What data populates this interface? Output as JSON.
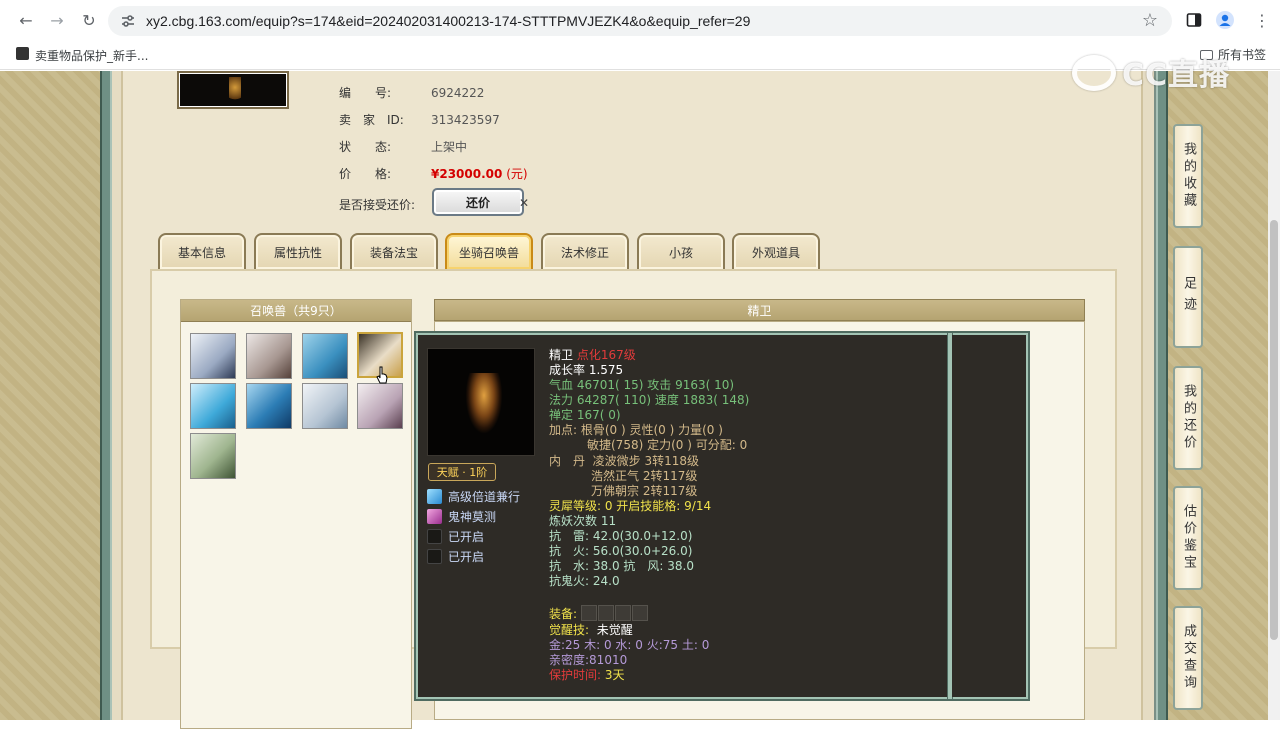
{
  "browser": {
    "url": "xy2.cbg.163.com/equip?s=174&eid=202402031400213-174-STTTPMVJEZK4&o&equip_refer=29",
    "bookmark": "卖重物品保护_新手...",
    "all_bookmarks": "所有书签",
    "watermark": "CC直播"
  },
  "item": {
    "rows": [
      {
        "label": "编　　号:",
        "value": "6924222"
      },
      {
        "label": "卖　家　ID:",
        "value": "313423597"
      },
      {
        "label": "状　　态:",
        "value": "上架中"
      },
      {
        "label": "价　　格:",
        "value": "¥23000.00",
        "unit": "(元)"
      }
    ],
    "counter_label": "是否接受还价:",
    "counter_button": "还价",
    "close_mark": "✕"
  },
  "tabs": [
    "基本信息",
    "属性抗性",
    "装备法宝",
    "坐骑召唤兽",
    "法术修正",
    "小孩",
    "外观道具"
  ],
  "active_tab": 3,
  "pet_panel": {
    "title": "召唤兽（共9只）",
    "selected": 3
  },
  "detail_title": "精卫",
  "tooltip": {
    "name": "精卫",
    "level": "点化167级",
    "growth": "成长率 1.575",
    "hp": "气血 46701( 15)",
    "attack": "攻击 9163( 10)",
    "mp": "法力 64287( 110)",
    "speed": "速度 1883( 148)",
    "zen": "禅定 167( 0)",
    "points1": "加点:  根骨(0 ) 灵性(0 ) 力量(0 )",
    "points2": "敏捷(758) 定力(0 ) 可分配:  0",
    "neidan_label": "内　丹",
    "neidan1": "凌波微步 3转118级",
    "neidan2": "浩然正气 2转117级",
    "neidan3": "万佛朝宗 2转117级",
    "lingxi": "灵犀等级:  0  开启技能格:  9/14",
    "lianyao": "炼妖次数 11",
    "res1": "抗　雷: 42.0(30.0+12.0)",
    "res2": "抗　火: 56.0(30.0+26.0)",
    "res3": "抗　水: 38.0 抗　风: 38.0",
    "res4": "抗鬼火: 24.0",
    "equip_label": "装备:",
    "awaken_label": "觉醒技:",
    "awaken_value": "未觉醒",
    "elements": "金:25 木: 0 水: 0 火:75 土: 0",
    "intimacy": "亲密度:81010",
    "protect_label": "保护时间:",
    "protect_value": "3天",
    "talent": "天赋 · 1阶",
    "skills": [
      "高级倍道兼行",
      "鬼神莫测",
      "已开启",
      "已开启"
    ]
  },
  "sidebar": [
    {
      "label": "我的收藏"
    },
    {
      "label": "足迹"
    },
    {
      "label": "我的还价"
    },
    {
      "label": "估价鉴宝"
    },
    {
      "label": "成交查询"
    }
  ],
  "colors": {
    "accent": "#c98a17",
    "price": "#d40000",
    "tooltip_bg": "#2e2b26",
    "frame_green": "#6f9085"
  }
}
